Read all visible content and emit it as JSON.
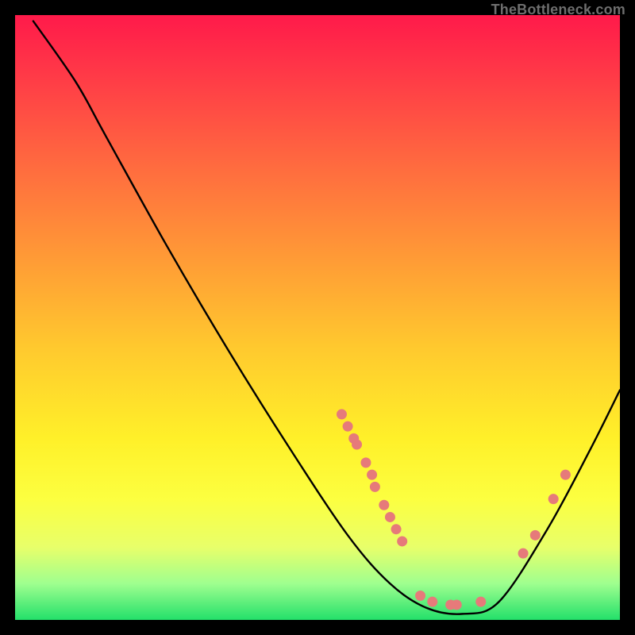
{
  "attribution": "TheBottleneck.com",
  "chart_data": {
    "type": "line",
    "title": "",
    "xlabel": "",
    "ylabel": "",
    "xlim": [
      0,
      100
    ],
    "ylim": [
      0,
      100
    ],
    "curve": {
      "name": "bottleneck-curve",
      "points": [
        {
          "x": 3,
          "y": 99
        },
        {
          "x": 10,
          "y": 89
        },
        {
          "x": 15,
          "y": 80
        },
        {
          "x": 25,
          "y": 62
        },
        {
          "x": 35,
          "y": 45
        },
        {
          "x": 45,
          "y": 29
        },
        {
          "x": 55,
          "y": 14
        },
        {
          "x": 62,
          "y": 6
        },
        {
          "x": 68,
          "y": 2
        },
        {
          "x": 74,
          "y": 1
        },
        {
          "x": 80,
          "y": 3
        },
        {
          "x": 88,
          "y": 15
        },
        {
          "x": 95,
          "y": 28
        },
        {
          "x": 100,
          "y": 38
        }
      ]
    },
    "markers": {
      "name": "highlight-dots",
      "color": "#e67a7a",
      "points": [
        {
          "x": 54,
          "y": 34
        },
        {
          "x": 55,
          "y": 32
        },
        {
          "x": 56,
          "y": 30
        },
        {
          "x": 56.5,
          "y": 29
        },
        {
          "x": 58,
          "y": 26
        },
        {
          "x": 59,
          "y": 24
        },
        {
          "x": 59.5,
          "y": 22
        },
        {
          "x": 61,
          "y": 19
        },
        {
          "x": 62,
          "y": 17
        },
        {
          "x": 63,
          "y": 15
        },
        {
          "x": 64,
          "y": 13
        },
        {
          "x": 67,
          "y": 4
        },
        {
          "x": 69,
          "y": 3
        },
        {
          "x": 72,
          "y": 2.5
        },
        {
          "x": 73,
          "y": 2.5
        },
        {
          "x": 77,
          "y": 3
        },
        {
          "x": 84,
          "y": 11
        },
        {
          "x": 86,
          "y": 14
        },
        {
          "x": 89,
          "y": 20
        },
        {
          "x": 91,
          "y": 24
        }
      ]
    }
  }
}
